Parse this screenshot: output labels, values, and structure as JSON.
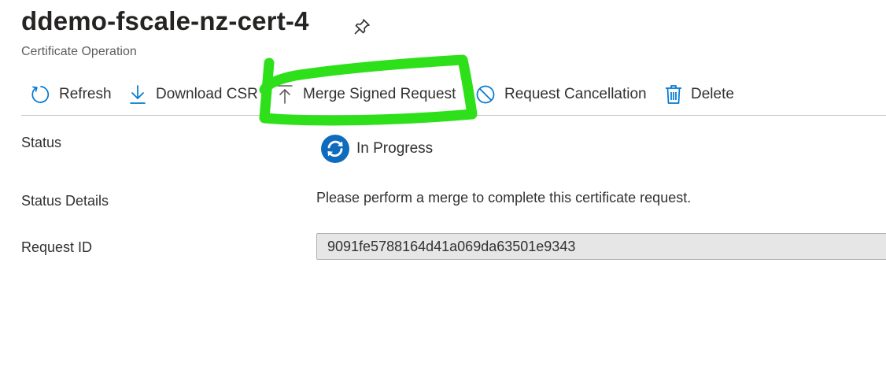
{
  "header": {
    "title": "ddemo-fscale-nz-cert-4",
    "subtitle": "Certificate Operation"
  },
  "toolbar": {
    "items": [
      {
        "label": "Refresh",
        "icon": "refresh-icon"
      },
      {
        "label": "Download CSR",
        "icon": "download-icon"
      },
      {
        "label": "Merge Signed Request",
        "icon": "upload-icon"
      },
      {
        "label": "Request Cancellation",
        "icon": "cancel-icon"
      },
      {
        "label": "Delete",
        "icon": "trash-icon"
      }
    ]
  },
  "details": {
    "status_label": "Status",
    "status_value": "In Progress",
    "status_icon": "sync-icon",
    "status_details_label": "Status Details",
    "status_details_value": "Please perform a merge to complete this certificate request.",
    "request_id_label": "Request ID",
    "request_id_value": "9091fe5788164d41a069da63501e9343"
  },
  "colors": {
    "accent": "#0078d4",
    "status_icon_bg": "#0f6cbd",
    "highlight_scribble": "#2ee01a",
    "readonly_field_bg": "#e6e6e6",
    "divider": "#c8c6c4"
  }
}
